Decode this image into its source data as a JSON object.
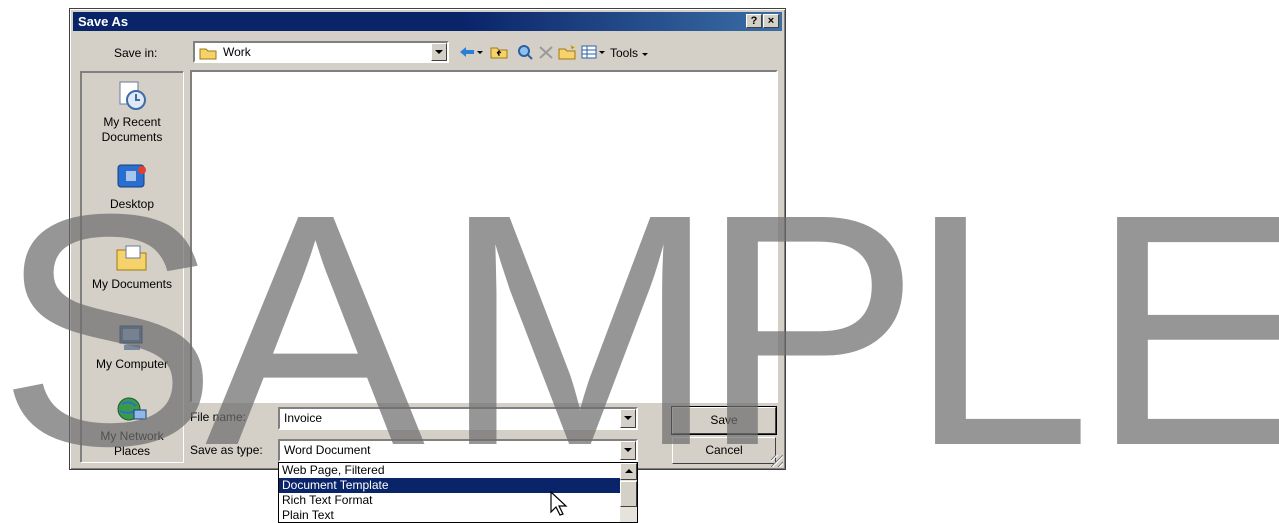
{
  "dialog": {
    "title": "Save As",
    "help_label": "?",
    "close_label": "×"
  },
  "save_in": {
    "label": "Save in:",
    "value": "Work"
  },
  "toolbar": {
    "tools_label": "Tools"
  },
  "places": [
    {
      "label": "My Recent Documents",
      "icon": "recent-documents-icon"
    },
    {
      "label": "Desktop",
      "icon": "desktop-icon"
    },
    {
      "label": "My Documents",
      "icon": "my-documents-icon"
    },
    {
      "label": "My Computer",
      "icon": "my-computer-icon"
    },
    {
      "label": "My Network Places",
      "icon": "network-places-icon"
    }
  ],
  "file_name": {
    "label": "File name:",
    "value": "Invoice"
  },
  "save_as_type": {
    "label": "Save as type:",
    "value": "Word Document"
  },
  "buttons": {
    "save": "Save",
    "cancel": "Cancel"
  },
  "type_options": [
    "Web Page, Filtered",
    "Document Template",
    "Rich Text Format",
    "Plain Text"
  ],
  "selected_option": "Document Template",
  "watermark": {
    "letters": [
      "S",
      "A",
      "M",
      "P",
      "L",
      "E"
    ]
  },
  "colors": {
    "titlebar": "#0a246a",
    "face": "#d4d0c8",
    "selection": "#0a246a"
  }
}
